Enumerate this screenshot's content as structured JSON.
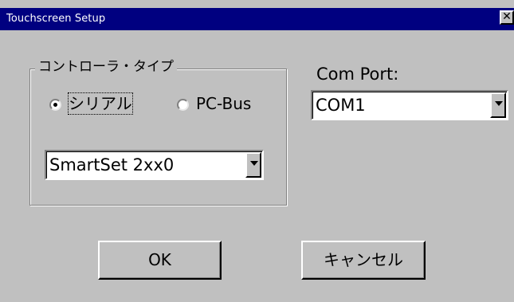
{
  "window": {
    "title": "Touchscreen Setup",
    "close_glyph": "✕"
  },
  "controller_group": {
    "label": "コントローラ・タイプ",
    "radios": [
      {
        "label": "シリアル",
        "selected": true
      },
      {
        "label": "PC-Bus",
        "selected": false
      }
    ],
    "model_select": {
      "value": "SmartSet 2xx0"
    }
  },
  "com_port": {
    "label": "Com Port:",
    "value": "COM1"
  },
  "buttons": {
    "ok": "OK",
    "cancel": "キャンセル"
  }
}
